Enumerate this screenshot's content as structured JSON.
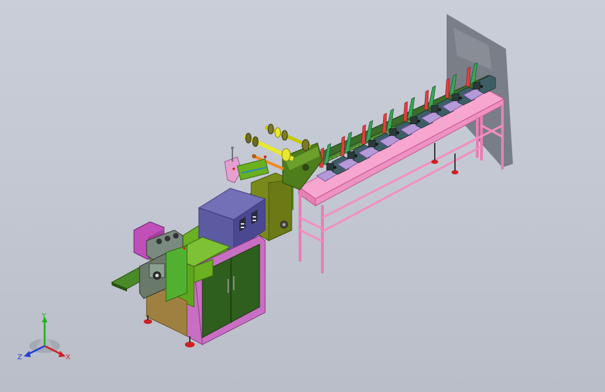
{
  "viewport": {
    "background_top": "#c9ced8",
    "background_bottom": "#b9bec8"
  },
  "model": {
    "colors": {
      "table_frame": "#f48fc0",
      "control_cabinet": "#5c5aa0",
      "cabinet_door": "#2f5f1e",
      "cabinet_side": "#c96fc3",
      "green_body": "#6ab020",
      "film_roll": "#e8e830",
      "orange_rod": "#f08a20",
      "feeder_green": "#3aa65a",
      "feeder_purple": "#b59ad8",
      "feeder_red": "#e04040",
      "outfeed_body": "#a08040",
      "foot": "#d02020"
    },
    "feeder_count": 8
  },
  "triad": {
    "x_label": "X",
    "y_label": "Y",
    "z_label": "Z",
    "x_color": "#d02020",
    "y_color": "#20b020",
    "z_color": "#2040d0"
  }
}
